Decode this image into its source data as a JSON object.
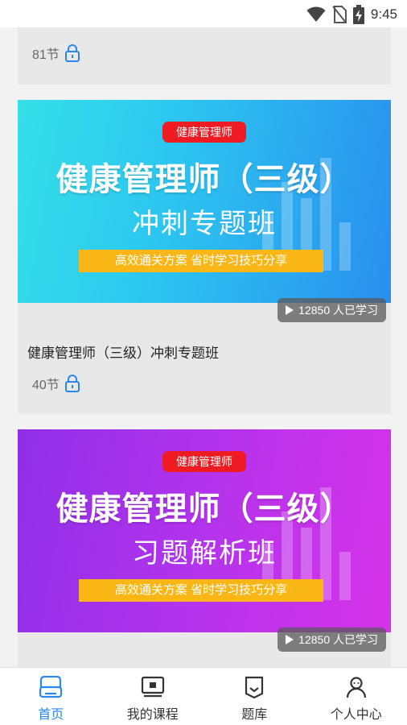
{
  "status_bar": {
    "time": "9:45",
    "icons": [
      "wifi-icon",
      "no-sim-icon",
      "battery-charging-icon"
    ]
  },
  "courses": [
    {
      "lessons": "81节"
    },
    {
      "banner": {
        "tag": "健康管理师",
        "title": "健康管理师（三级）",
        "subtitle": "冲刺专题班",
        "slogan": "高效通关方案  省时学习技巧分享",
        "theme": "#2cc6f0"
      },
      "learners": "12850 人已学习",
      "title": "健康管理师（三级）冲刺专题班",
      "lessons": "40节"
    },
    {
      "banner": {
        "tag": "健康管理师",
        "title": "健康管理师（三级）",
        "subtitle": "习题解析班",
        "slogan": "高效通关方案  省时学习技巧分享",
        "theme": "#b433ec"
      },
      "learners": "12850 人已学习"
    }
  ],
  "nav": {
    "accent": "#2a87f0",
    "items": [
      {
        "label": "首页",
        "icon": "home-icon",
        "active": true
      },
      {
        "label": "我的课程",
        "icon": "my-courses-icon",
        "active": false
      },
      {
        "label": "题库",
        "icon": "question-bank-icon",
        "active": false
      },
      {
        "label": "个人中心",
        "icon": "profile-icon",
        "active": false
      }
    ]
  }
}
